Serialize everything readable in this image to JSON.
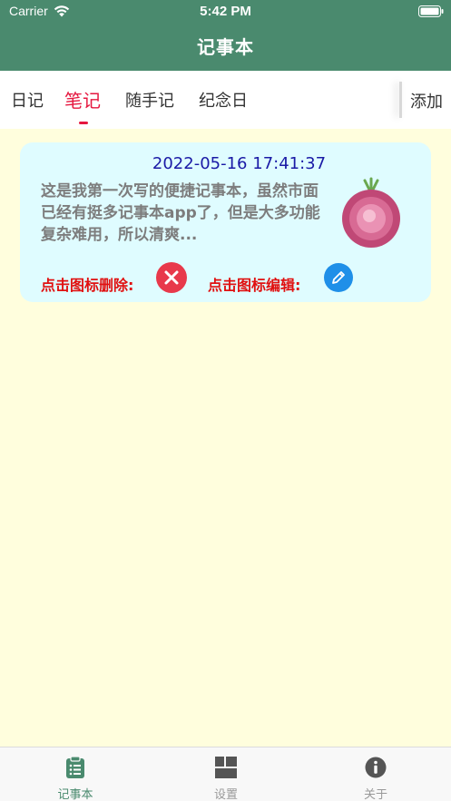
{
  "status_bar": {
    "carrier": "Carrier",
    "time": "5:42 PM",
    "wifi_icon": "wifi-icon",
    "battery_icon": "battery-icon"
  },
  "nav": {
    "title": "记事本"
  },
  "tabs": [
    {
      "label": "日记",
      "active": false
    },
    {
      "label": "笔记",
      "active": true
    },
    {
      "label": "随手记",
      "active": false
    },
    {
      "label": "纪念日",
      "active": false
    }
  ],
  "add_label": "添加",
  "note": {
    "datetime": "2022-05-16 17:41:37",
    "preview": "这是我第一次写的便捷记事本，虽然市面已经有挺多记事本app了，但是大多功能复杂难用，所以清爽...",
    "image_icon": "onion-icon",
    "delete_label": "点击图标删除:",
    "edit_label": "点击图标编辑:",
    "delete_icon": "close-icon",
    "edit_icon": "pencil-icon"
  },
  "bottom_nav": [
    {
      "label": "记事本",
      "icon": "clipboard-icon",
      "active": true
    },
    {
      "label": "设置",
      "icon": "grid-icon",
      "active": false
    },
    {
      "label": "关于",
      "icon": "info-icon",
      "active": false
    }
  ],
  "colors": {
    "header": "#4a8a6e",
    "background": "#fffedd",
    "card": "#dffcff",
    "active_tab": "#e5173f",
    "date_text": "#1a1aa6",
    "action_label": "#e01010",
    "delete_button": "#e8394b",
    "edit_button": "#1f8fe8"
  }
}
